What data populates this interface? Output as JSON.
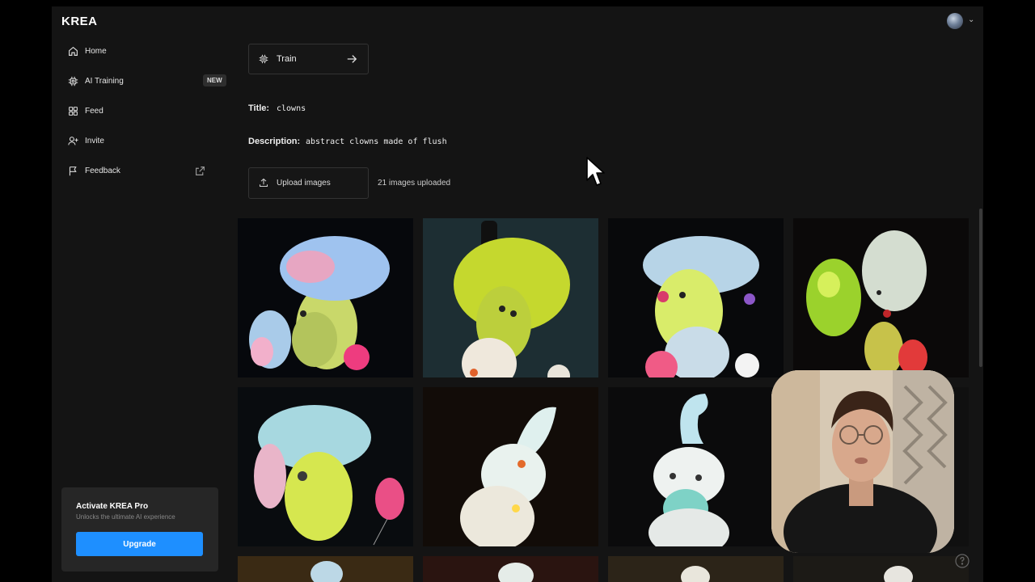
{
  "app": {
    "logo": "KREA"
  },
  "sidebar": {
    "items": [
      {
        "label": "Home",
        "icon": "home-icon"
      },
      {
        "label": "AI Training",
        "icon": "cpu-icon",
        "badge": "NEW"
      },
      {
        "label": "Feed",
        "icon": "grid-icon"
      },
      {
        "label": "Invite",
        "icon": "user-plus-icon"
      },
      {
        "label": "Feedback",
        "icon": "flag-icon",
        "trailing_icon": "external-link-icon"
      }
    ],
    "pro_card": {
      "title": "Activate KREA Pro",
      "subtitle": "Unlocks the ultimate AI experience",
      "button_label": "Upgrade"
    }
  },
  "main": {
    "train_button_label": "Train",
    "title_label": "Title:",
    "title_value": "clowns",
    "description_label": "Description:",
    "description_value": "abstract clowns made of flush",
    "upload_button_label": "Upload images",
    "upload_status": "21 images uploaded"
  },
  "colors": {
    "accent": "#1e8fff",
    "background": "#141414",
    "card": "#262626"
  }
}
